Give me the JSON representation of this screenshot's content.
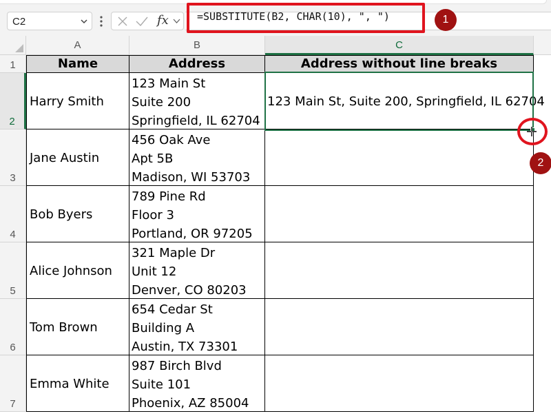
{
  "name_box": {
    "ref": "C2"
  },
  "formula_bar": {
    "fx_label": "fx",
    "formula": "=SUBSTITUTE(B2, CHAR(10), \", \")"
  },
  "badges": [
    "1",
    "2"
  ],
  "columns": [
    "A",
    "B",
    "C"
  ],
  "rows": [
    "1",
    "2",
    "3",
    "4",
    "5",
    "6",
    "7"
  ],
  "headers": {
    "name": "Name",
    "address": "Address",
    "result": "Address without line breaks"
  },
  "records": [
    {
      "name": "Harry Smith",
      "address": [
        "123 Main St",
        "Suite 200",
        "Springfield, IL 62704"
      ],
      "result": "123 Main St, Suite 200, Springfield, IL 62704"
    },
    {
      "name": "Jane Austin",
      "address": [
        "456 Oak Ave",
        "Apt 5B",
        "Madison, WI 53703"
      ],
      "result": ""
    },
    {
      "name": "Bob Byers",
      "address": [
        "789 Pine Rd",
        "Floor 3",
        "Portland, OR 97205"
      ],
      "result": ""
    },
    {
      "name": "Alice Johnson",
      "address": [
        "321 Maple Dr",
        "Unit 12",
        "Denver, CO 80203"
      ],
      "result": ""
    },
    {
      "name": "Tom Brown",
      "address": [
        "654 Cedar St",
        "Building A",
        "Austin, TX 73301"
      ],
      "result": ""
    },
    {
      "name": "Emma White",
      "address": [
        "987 Birch Blvd",
        "Suite 101",
        "Phoenix, AZ 85004"
      ],
      "result": ""
    }
  ],
  "colors": {
    "accent_green": "#1e7145",
    "highlight_red": "#e0141e",
    "badge_red": "#a01212",
    "header_fill": "#d9d9d9"
  }
}
